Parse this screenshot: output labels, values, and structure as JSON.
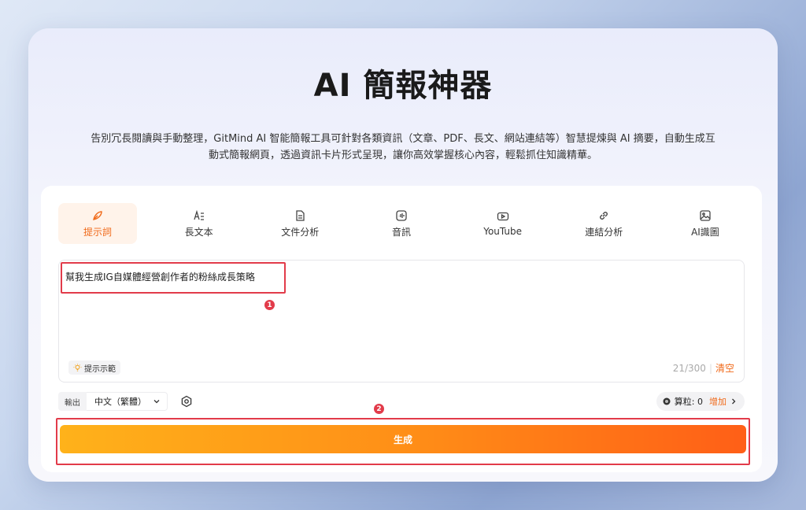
{
  "header": {
    "title": "AI 簡報神器",
    "description": "告別冗長閱讀與手動整理，GitMind AI 智能簡報工具可針對各類資訊（文章、PDF、長文、網站連結等）智慧提煉與 AI 摘要，自動生成互動式簡報網頁，透過資訊卡片形式呈現，讓你高效掌握核心內容，輕鬆抓住知識精華。"
  },
  "tabs": [
    {
      "label": "提示詞",
      "icon": "feather-icon",
      "active": true
    },
    {
      "label": "長文本",
      "icon": "text-lines-icon",
      "active": false
    },
    {
      "label": "文件分析",
      "icon": "document-icon",
      "active": false
    },
    {
      "label": "音訊",
      "icon": "audio-icon",
      "active": false
    },
    {
      "label": "YouTube",
      "icon": "youtube-icon",
      "active": false
    },
    {
      "label": "連結分析",
      "icon": "link-icon",
      "active": false
    },
    {
      "label": "AI識圖",
      "icon": "image-icon",
      "active": false
    }
  ],
  "input": {
    "value": "幫我生成IG自媒體經營創作者的粉絲成長策略",
    "hint_label": "提示示範",
    "counter": "21/300",
    "clear_label": "清空"
  },
  "annotations": {
    "badge1": "1",
    "badge2": "2"
  },
  "output": {
    "label": "輸出",
    "language": "中文（繁體）"
  },
  "credits": {
    "text": "算粒: 0",
    "add_label": "增加"
  },
  "generate": {
    "label": "生成"
  },
  "colors": {
    "accent": "#f06a1a",
    "annotation_red": "#e23b4a"
  }
}
